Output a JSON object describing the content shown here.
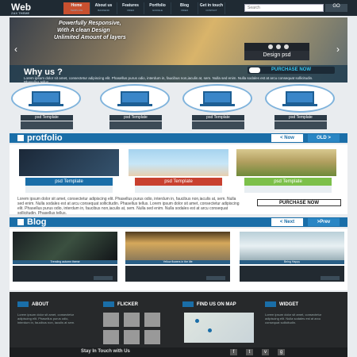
{
  "brand": {
    "logo": "Web",
    "tagline": "ZAX THEME"
  },
  "nav": [
    {
      "label": "Home",
      "sub": "TEMPLATE"
    },
    {
      "label": "About us",
      "sub": "BACKEND"
    },
    {
      "label": "Features",
      "sub": "VIDEO"
    },
    {
      "label": "Portfolio",
      "sub": "GOOGLE"
    },
    {
      "label": "Blog",
      "sub": "VIDEO"
    },
    {
      "label": "Get in touch",
      "sub": "CONTACT"
    }
  ],
  "search": {
    "placeholder": "Search",
    "button": "GO"
  },
  "hero": {
    "lines": [
      "Powerfully Responsive,",
      "With A clean Design",
      "Unlimited Amount of layers"
    ],
    "design_label": "Design psd",
    "why_title": "Why us ?",
    "why_text": "Lorem ipsum dolor sit amet, consectetur adipiscing elit. Phasellus purus odio, interdum in, faucibus non,iaculis at, sem. Nulla sed enim. Nulla sodales est at arcu consequat sollicitudin. Phasellus tellus.",
    "purchase": "PURCHASE NOW"
  },
  "cards": [
    {
      "label": "psd Template"
    },
    {
      "label": "psd Template"
    },
    {
      "label": "psd Template"
    },
    {
      "label": "psd Template"
    }
  ],
  "portfolio": {
    "title": "protfolio",
    "new_btn": "< Now",
    "old_btn": "OLD >",
    "items": [
      {
        "label": "psd Template"
      },
      {
        "label": "psd Template"
      },
      {
        "label": "psd Template"
      }
    ],
    "text": "Lorem ipsum dolor sit amet, consectetur adipiscing elit. Phasellus purus odio, interdum in, faucibus non,iaculis at, sem. Nulla sed enim. Nulla sodales est at arcu consequat sollicitudin. Phasellus tellus. Lorem ipsum dolor sit amet, consectetur adipiscing elit. Phasellus purus odio, interdum in, faucibus non,iaculis at, sem. Nulla sed enim. Nulla sodales est at arcu consequat sollicitudin. Phasellus tellus.",
    "purchase": "PURCHASE NOW"
  },
  "blog": {
    "title": "Blog",
    "next": "< Next",
    "prev": ">Prev",
    "posts": [
      {
        "caption": "Trending autumn theme"
      },
      {
        "caption": "Yellow flowers in the life"
      },
      {
        "caption": "Being Happy"
      }
    ]
  },
  "footer": {
    "about": "ABOUT",
    "about_text": "Lorem ipsum dolor sit amet, consectetur adipiscing elit. Phasellus purus odio, interdum in, faucibus non, iaculis at sem.",
    "flicker": "FLICKER",
    "map": "FIND US ON MAP",
    "widget": "WIDGET",
    "widget_text": "Lorem ipsum dolor sit amet, consectetur adipiscing elit. Nulla sodales est at arcu consequat sollicitudin.",
    "stay": "Stay In Touch with Us",
    "social": [
      "f",
      "t",
      "v",
      "g"
    ]
  },
  "colors": {
    "accent": "#1a6ea8",
    "nav_active": "#c8502f",
    "dark": "#27292b"
  }
}
